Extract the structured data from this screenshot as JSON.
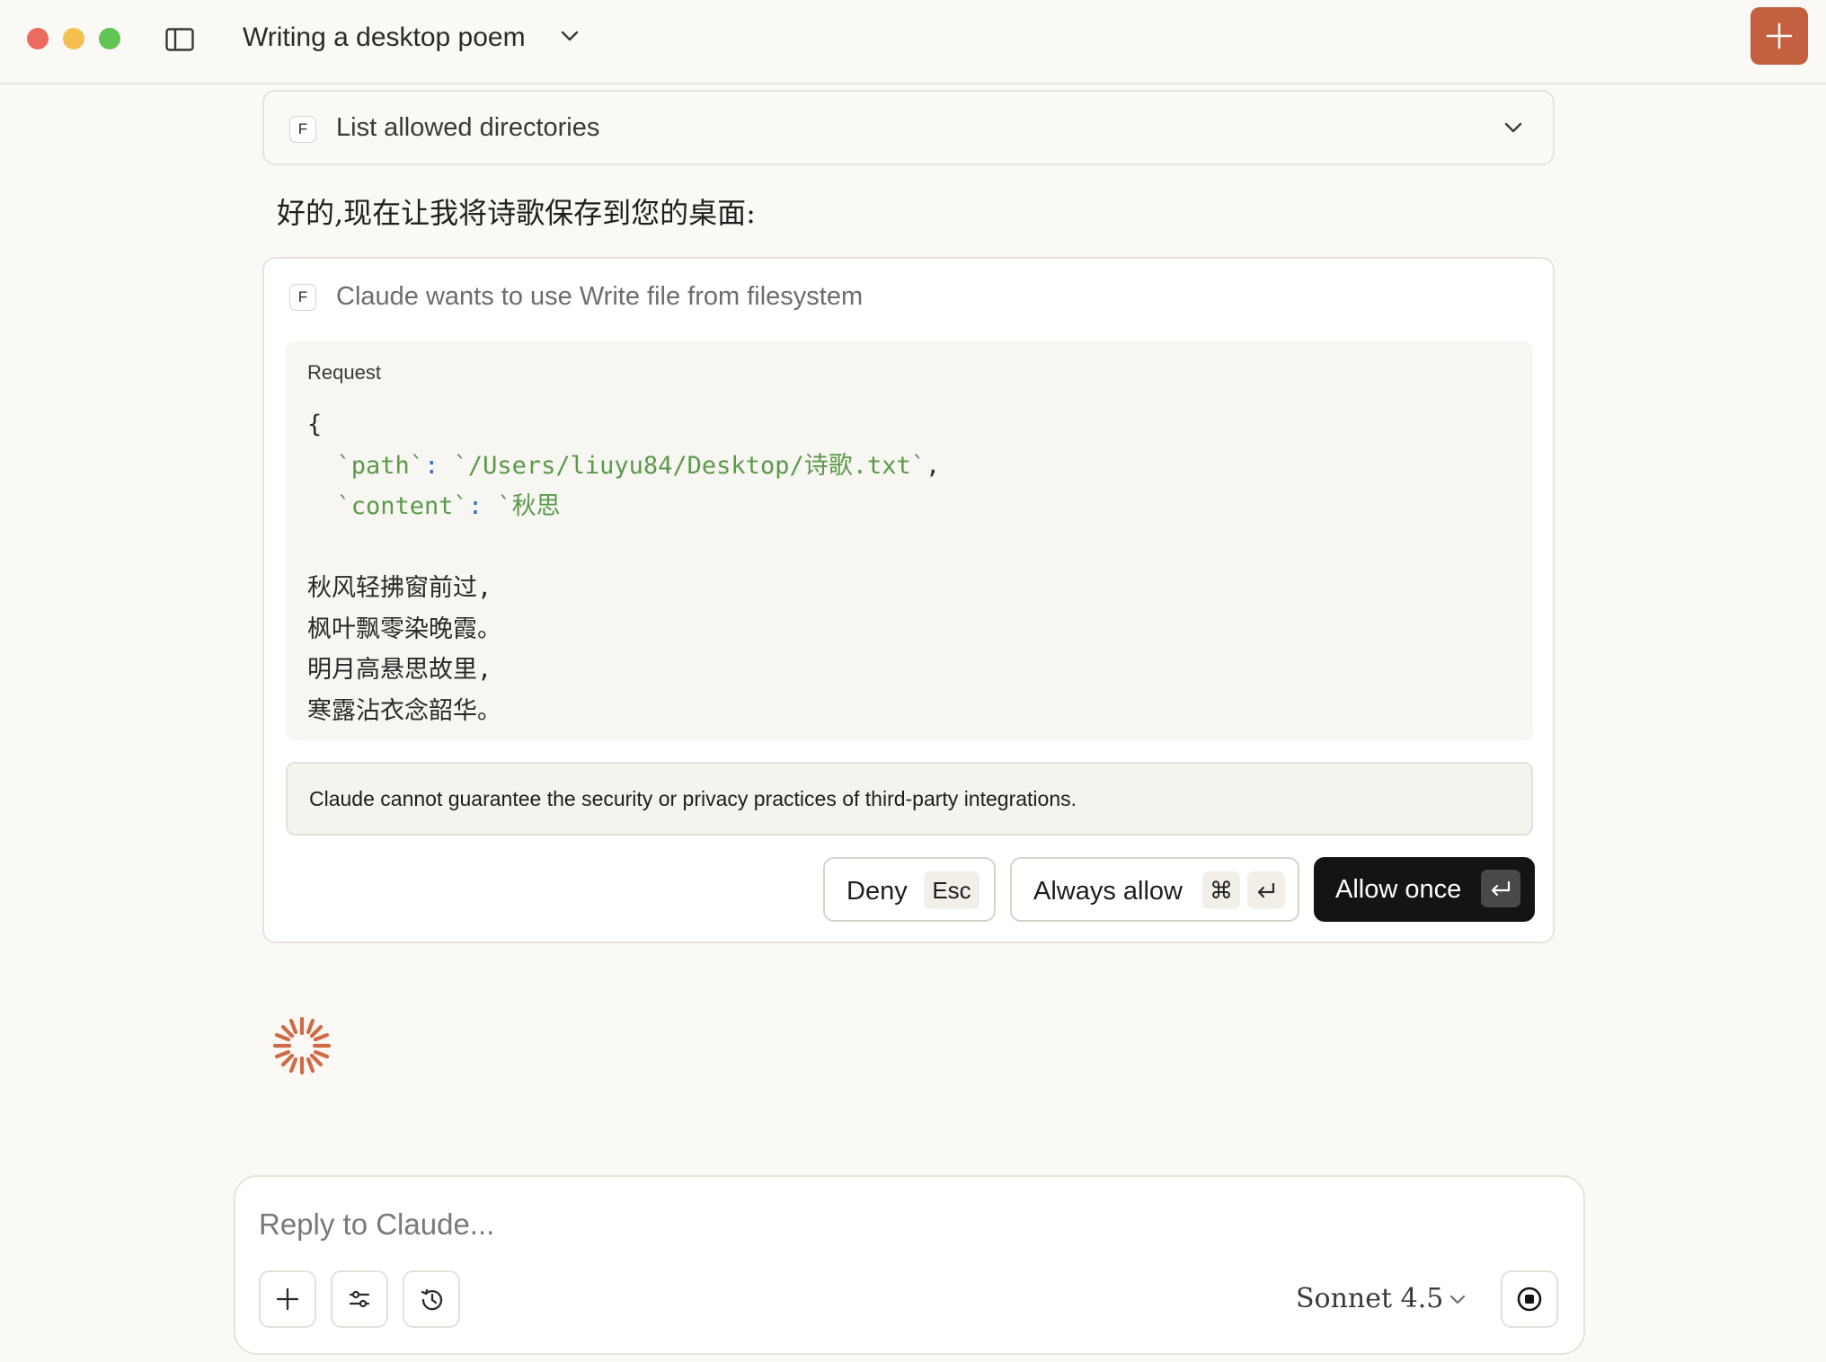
{
  "window": {
    "title": "Writing a desktop poem"
  },
  "tools": {
    "collapsed": {
      "badge": "F",
      "label": "List allowed directories"
    }
  },
  "message": {
    "text": "好的,现在让我将诗歌保存到您的桌面:"
  },
  "permission": {
    "badge": "F",
    "title": "Claude wants to use Write file from filesystem",
    "request_label": "Request",
    "code": {
      "open_brace": "{",
      "path_key": "`path`",
      "path_value": "`/Users/liuyu84/Desktop/诗歌.txt`",
      "content_key": "`content`",
      "content_value_start": "`秋思",
      "lines": [
        "秋风轻拂窗前过,",
        "枫叶飘零染晚霞。",
        "明月高悬思故里,",
        "寒露沾衣念韶华。"
      ]
    },
    "warning": "Claude cannot guarantee the security or privacy practices of third-party integrations.",
    "buttons": {
      "deny": {
        "label": "Deny",
        "shortcut": "Esc"
      },
      "always_allow": {
        "label": "Always allow",
        "shortcut": "⌘"
      },
      "allow_once": {
        "label": "Allow once"
      }
    }
  },
  "composer": {
    "placeholder": "Reply to Claude...",
    "model": "Sonnet 4.5"
  },
  "colors": {
    "accent": "#c2603f",
    "background": "#faf9f5",
    "primary_button": "#141413",
    "code_key": "#5a9a48",
    "code_punct": "#2e6fd6"
  }
}
